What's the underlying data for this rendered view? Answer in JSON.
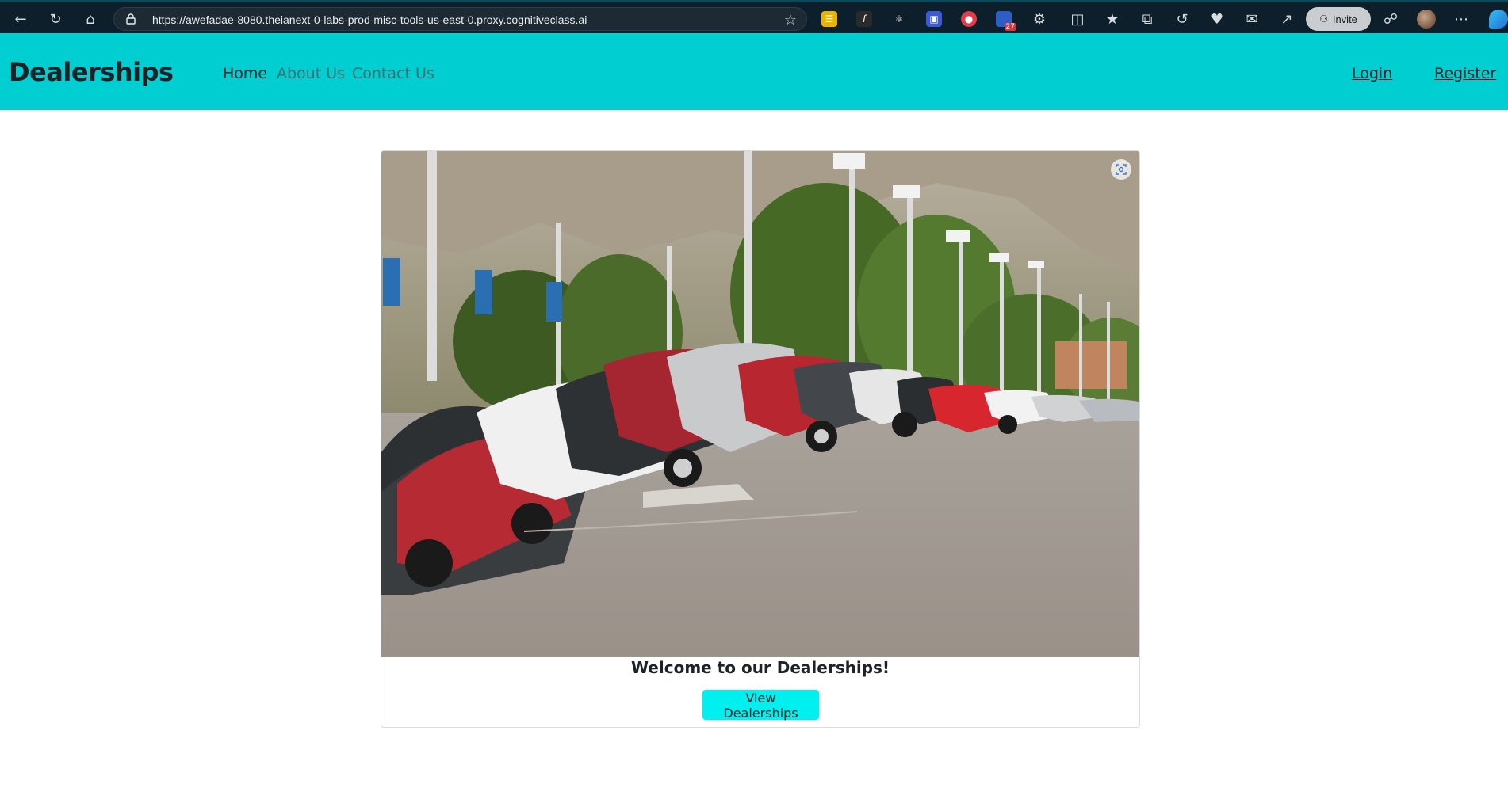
{
  "browser": {
    "url": "https://awefadae-8080.theianext-0-labs-prod-misc-tools-us-east-0.proxy.cognitiveclass.ai",
    "invite_label": "Invite",
    "extension_badge": "27"
  },
  "navbar": {
    "brand": "Dealerships",
    "links": [
      {
        "label": "Home",
        "active": true
      },
      {
        "label": "About Us",
        "active": false
      },
      {
        "label": "Contact Us",
        "active": false
      }
    ],
    "login_label": "Login",
    "register_label": "Register",
    "background_color": "#00ced1"
  },
  "main": {
    "hero_image": "car-dealership-parking-lot",
    "welcome_text": "Welcome to our Dealerships!",
    "view_button_label": "View Dealerships",
    "button_color": "#00f0f0"
  }
}
